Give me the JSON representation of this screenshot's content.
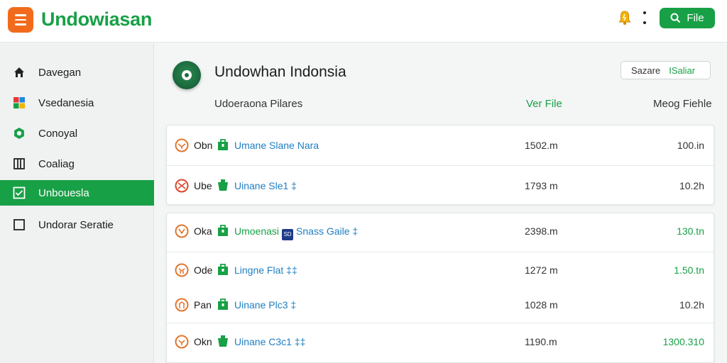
{
  "header": {
    "app_title": "Undowiasan",
    "file_button_label": "File"
  },
  "sidebar": {
    "items": [
      {
        "label": "Davegan",
        "icon": "home-icon",
        "active": false
      },
      {
        "label": "Vsedanesia",
        "icon": "grid-icon",
        "active": false
      },
      {
        "label": "Conoyal",
        "icon": "gear-icon",
        "active": false
      },
      {
        "label": "Coaliag",
        "icon": "book-icon",
        "active": false
      },
      {
        "label": "Unbouesla",
        "icon": "checkbox-icon",
        "active": true
      },
      {
        "label": "Undorar Seratie",
        "icon": "square-icon",
        "active": false
      }
    ]
  },
  "main": {
    "title": "Undowhan Indonsia",
    "search": {
      "label": "Sazare",
      "value": "ISaliar"
    },
    "columns": [
      "Udoeraona Pilares",
      "Ver File",
      "Meog Fiehle"
    ],
    "groups": [
      {
        "rows": [
          {
            "code": "Obn",
            "name": "Umane Slane Nara",
            "size": "1502.m",
            "amount": "100.in",
            "amount_green": false
          },
          {
            "code": "Ube",
            "name": "Uinane Sle1 ‡",
            "size": "1793 m",
            "amount": "10.2h",
            "amount_green": false
          }
        ]
      },
      {
        "rows": [
          {
            "code": "Oka",
            "name": "Umoenasi",
            "badge": "SD",
            "name2": "Snass Gaile ‡",
            "size": "2398.m",
            "amount": "130.tn",
            "amount_green": true
          },
          {
            "code": "Ode",
            "name": "Lingne Flat ‡‡",
            "size": "1272 m",
            "amount": "1.50.tn",
            "amount_green": true
          },
          {
            "code": "Pan",
            "name": "Uinane Plc3 ‡",
            "size": "1028 m",
            "amount": "10.2h",
            "amount_green": false
          },
          {
            "code": "Okn",
            "name": "Uinane C3c1 ‡‡",
            "size": "1190.m",
            "amount": "1300.310",
            "amount_green": true
          }
        ]
      }
    ]
  },
  "colors": {
    "brand_green": "#18a046",
    "menu_orange": "#f26b1d",
    "link_blue": "#1f7fc2",
    "ring_orange": "#e0762e"
  }
}
